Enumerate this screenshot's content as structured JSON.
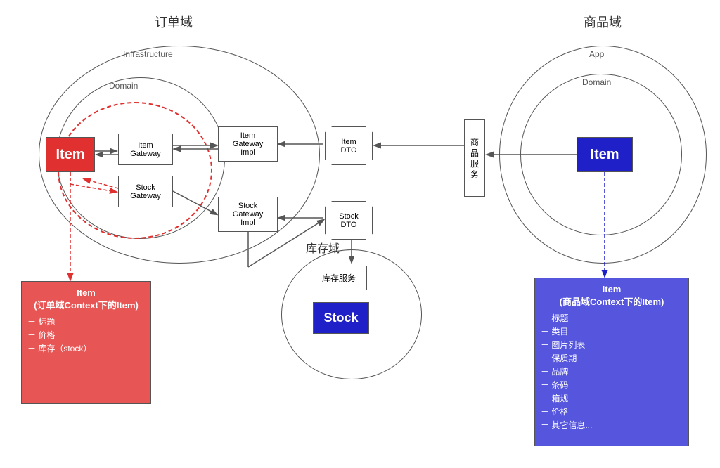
{
  "title_left": "订单域",
  "title_right": "商品域",
  "title_stock_domain": "库存域",
  "label_infrastructure": "Infrastructure",
  "label_domain_left": "Domain",
  "label_domain_right": "Domain",
  "label_app": "App",
  "item_left": "Item",
  "item_right": "Item",
  "item_gateway": "Item\nGateway",
  "stock_gateway": "Stock\nGateway",
  "item_gateway_impl": "Item\nGateway\nImpl",
  "stock_gateway_impl": "Stock\nGateway\nImpl",
  "item_dto": "Item\nDTO",
  "stock_dto": "Stock\nDTO",
  "shangpin_service": "商\n品\n服\n务",
  "kucun_service": "库存服务",
  "stock_label": "Stock",
  "info_left_title": "Item\n(订单域Context下的Item)",
  "info_left_lines": [
    "－ 标题",
    "－ 价格",
    "－ 库存（stock）"
  ],
  "info_right_title": "Item\n(商品域Context下的Item)",
  "info_right_lines": [
    "－ 标题",
    "－ 类目",
    "－ 图片列表",
    "－ 保质期",
    "－ 品牌",
    "－ 条码",
    "－ 箱规",
    "－ 价格",
    "－ 其它信息..."
  ]
}
